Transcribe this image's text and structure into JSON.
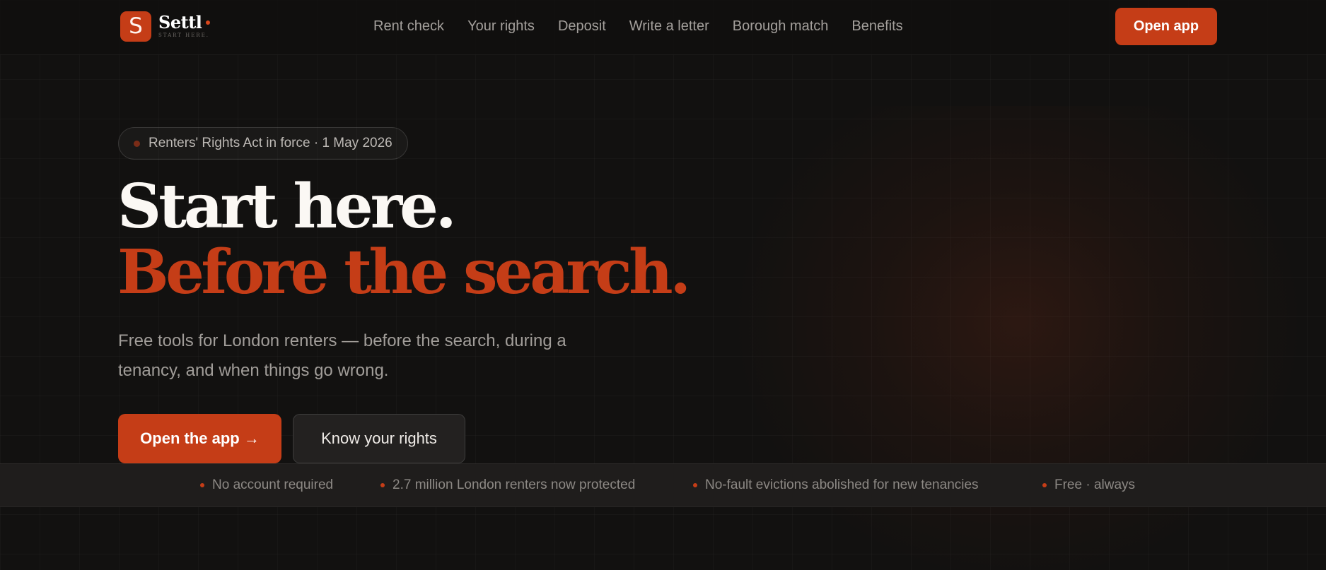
{
  "colors": {
    "accent": "#c53d17",
    "background": "#121110",
    "heading": "#fbf8f4",
    "muted_text": "#a19d99"
  },
  "header": {
    "logo": {
      "mark": "S",
      "name": "Settl",
      "tagline": "START HERE."
    },
    "nav": [
      {
        "label": "Rent check"
      },
      {
        "label": "Your rights"
      },
      {
        "label": "Deposit"
      },
      {
        "label": "Write a letter"
      },
      {
        "label": "Borough match"
      },
      {
        "label": "Benefits"
      }
    ],
    "cta_label": "Open app"
  },
  "hero": {
    "badge": "Renters' Rights Act in force · 1 May 2026",
    "title_line1": "Start here.",
    "title_line2": "Before the search.",
    "subtitle_line1": "Free tools for London renters — before the search, during a",
    "subtitle_line2": "tenancy, and when things go wrong.",
    "primary_button": "Open the app →",
    "secondary_button": "Know your rights"
  },
  "strip": {
    "items": [
      {
        "text": "No account required"
      },
      {
        "text": "2.7 million London renters now protected"
      },
      {
        "text": "No-fault evictions abolished for new tenancies"
      },
      {
        "text": "Free · always"
      }
    ]
  }
}
